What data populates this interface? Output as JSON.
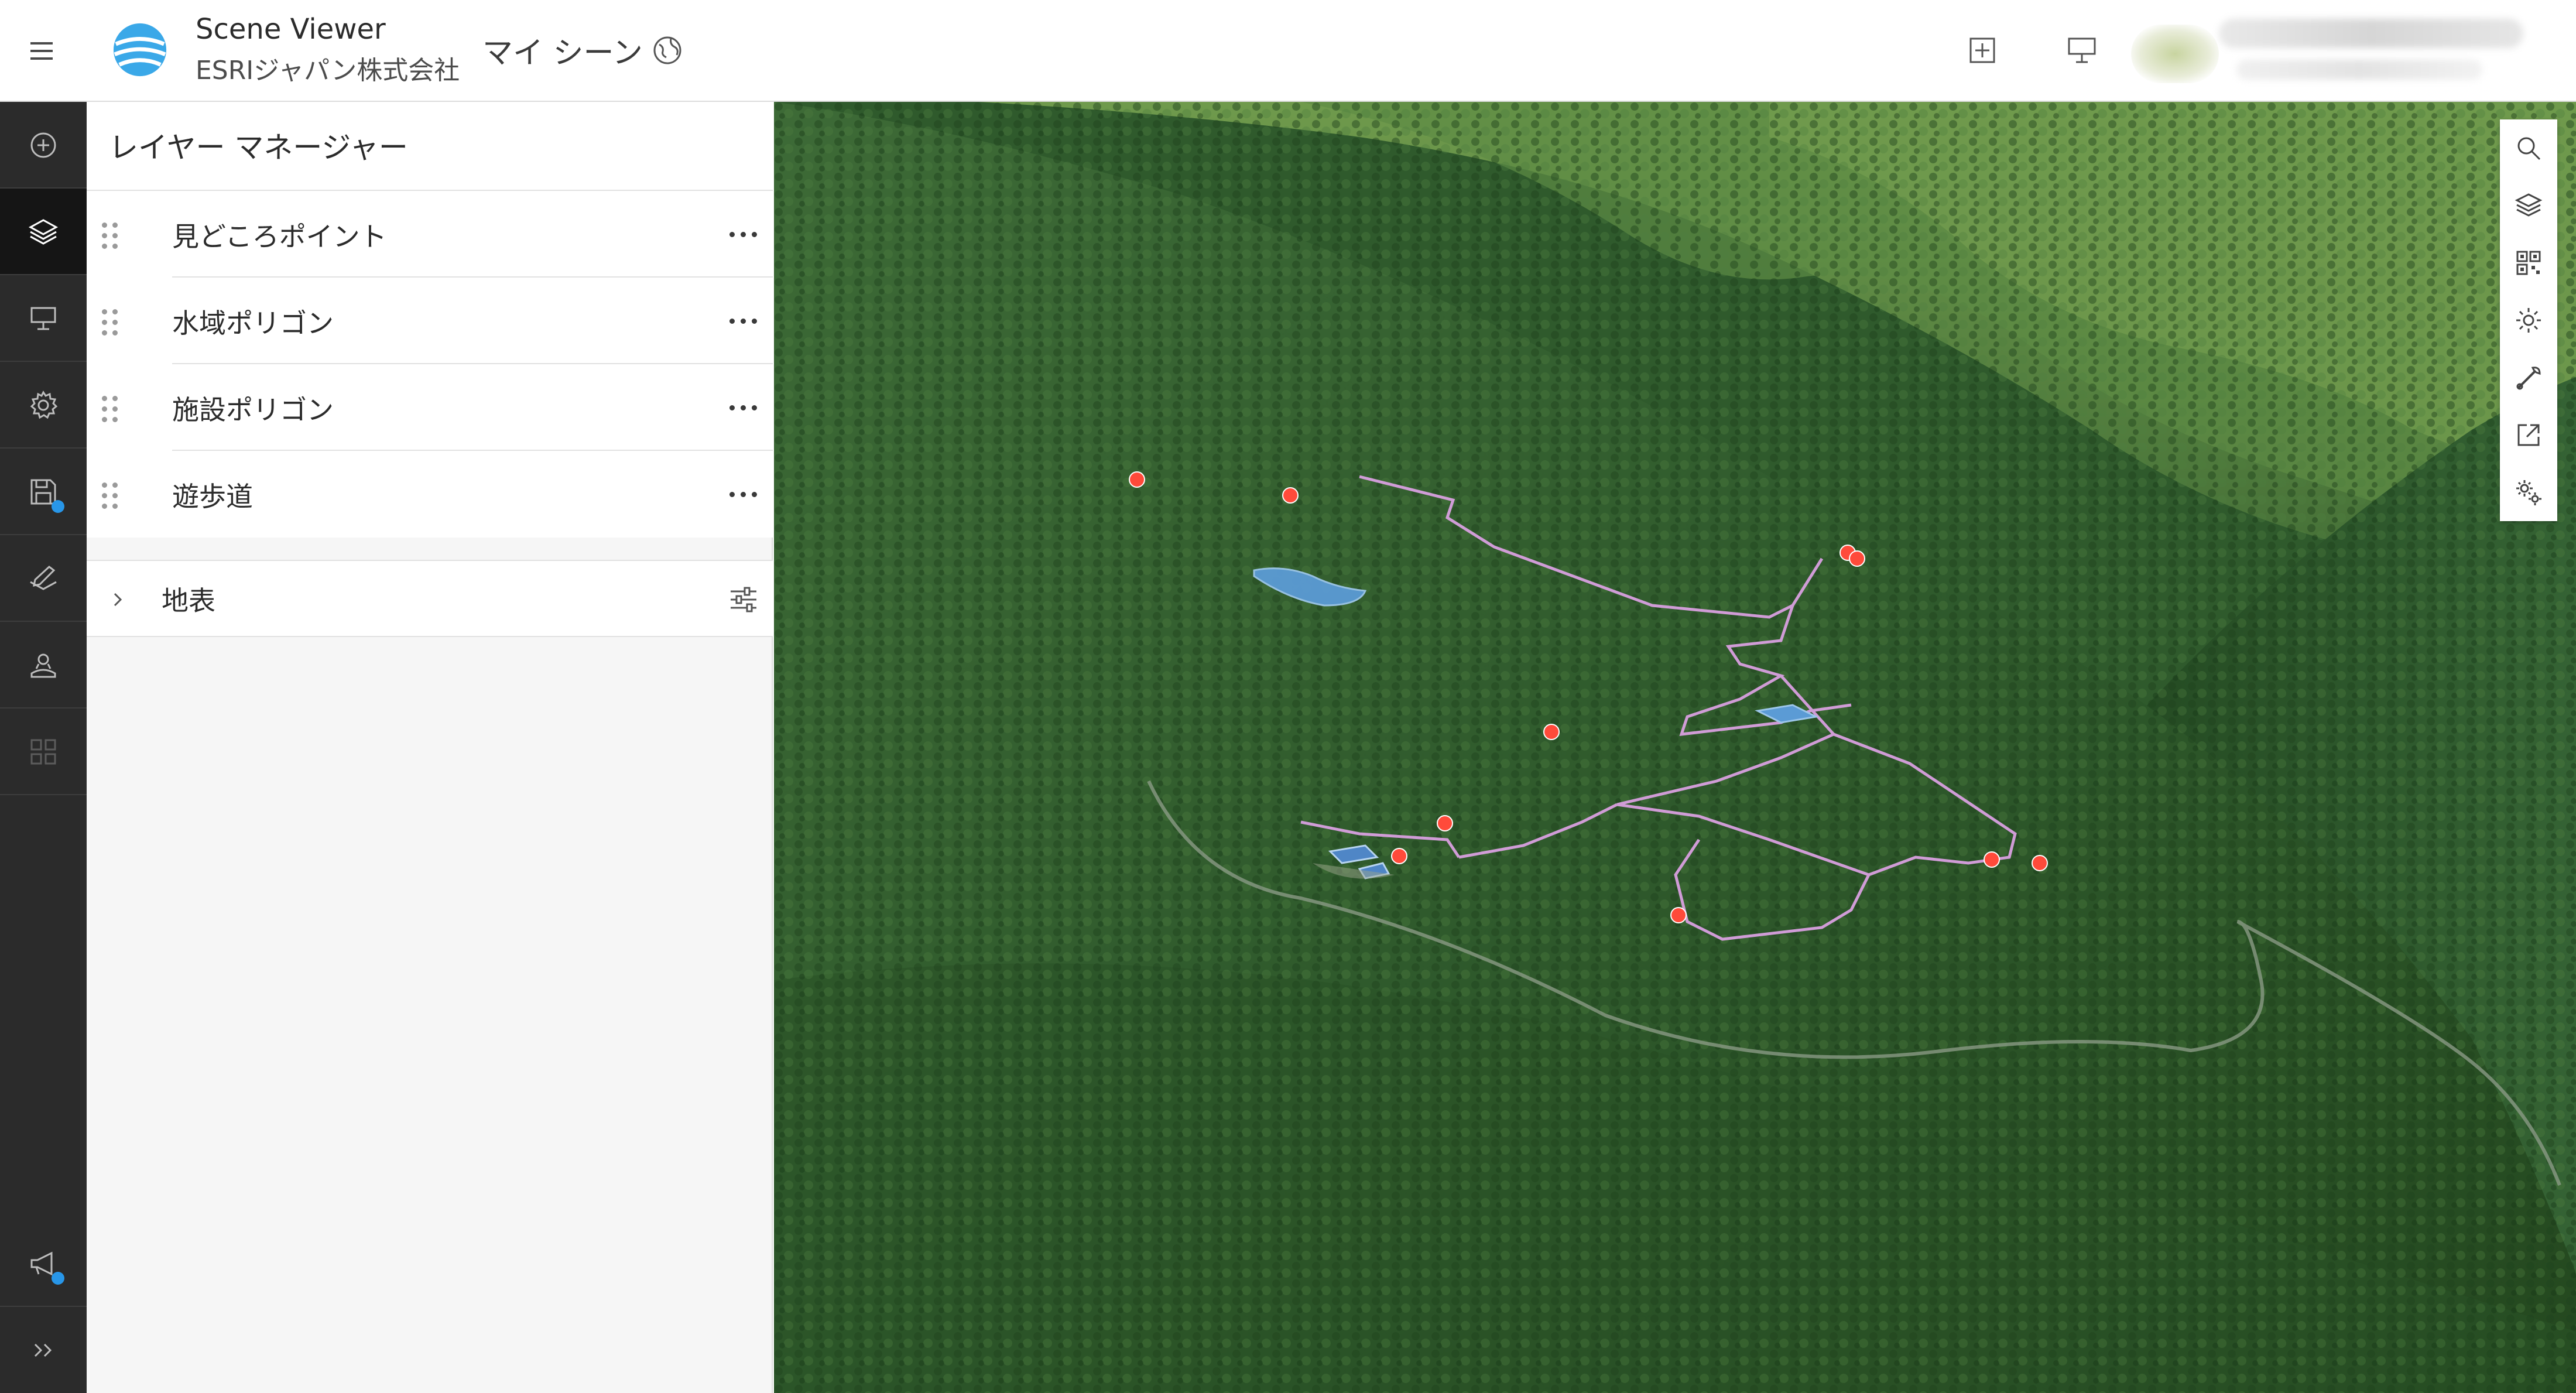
{
  "header": {
    "app_title": "Scene Viewer",
    "org_name": "ESRIジャパン株式会社",
    "scene_title": "マイ シーン",
    "user": {
      "blurred": true
    }
  },
  "sidebar": {
    "items": [
      {
        "icon": "add-icon",
        "active": false
      },
      {
        "icon": "layers-icon",
        "active": true
      },
      {
        "icon": "presentation-icon",
        "active": false
      },
      {
        "icon": "gear-icon",
        "active": false
      },
      {
        "icon": "save-icon",
        "active": false,
        "badge": true
      },
      {
        "icon": "edit-icon",
        "active": false
      },
      {
        "icon": "widgets-icon",
        "active": false
      },
      {
        "icon": "grid-icon",
        "active": false,
        "disabled": true
      }
    ],
    "bottom": [
      {
        "icon": "announcement-icon",
        "badge": true
      },
      {
        "icon": "expand-icon"
      }
    ]
  },
  "layer_panel": {
    "title": "レイヤー マネージャー",
    "layers": [
      {
        "label": "見どころポイント"
      },
      {
        "label": "水域ポリゴン"
      },
      {
        "label": "施設ポリゴン"
      },
      {
        "label": "遊歩道"
      }
    ],
    "ground": {
      "label": "地表"
    }
  },
  "map_tools": [
    {
      "icon": "search-icon"
    },
    {
      "icon": "layers-icon"
    },
    {
      "icon": "qr-code-icon"
    },
    {
      "icon": "sun-icon"
    },
    {
      "icon": "measure-icon"
    },
    {
      "icon": "share-icon"
    },
    {
      "icon": "settings-gear-icon"
    }
  ],
  "colors": {
    "rail_bg": "#2b2b2b",
    "rail_active": "#151515",
    "badge": "#2896e8",
    "point": "#ff4a3a",
    "trail": "#d9a0e0",
    "water": "#5b9bd5"
  }
}
